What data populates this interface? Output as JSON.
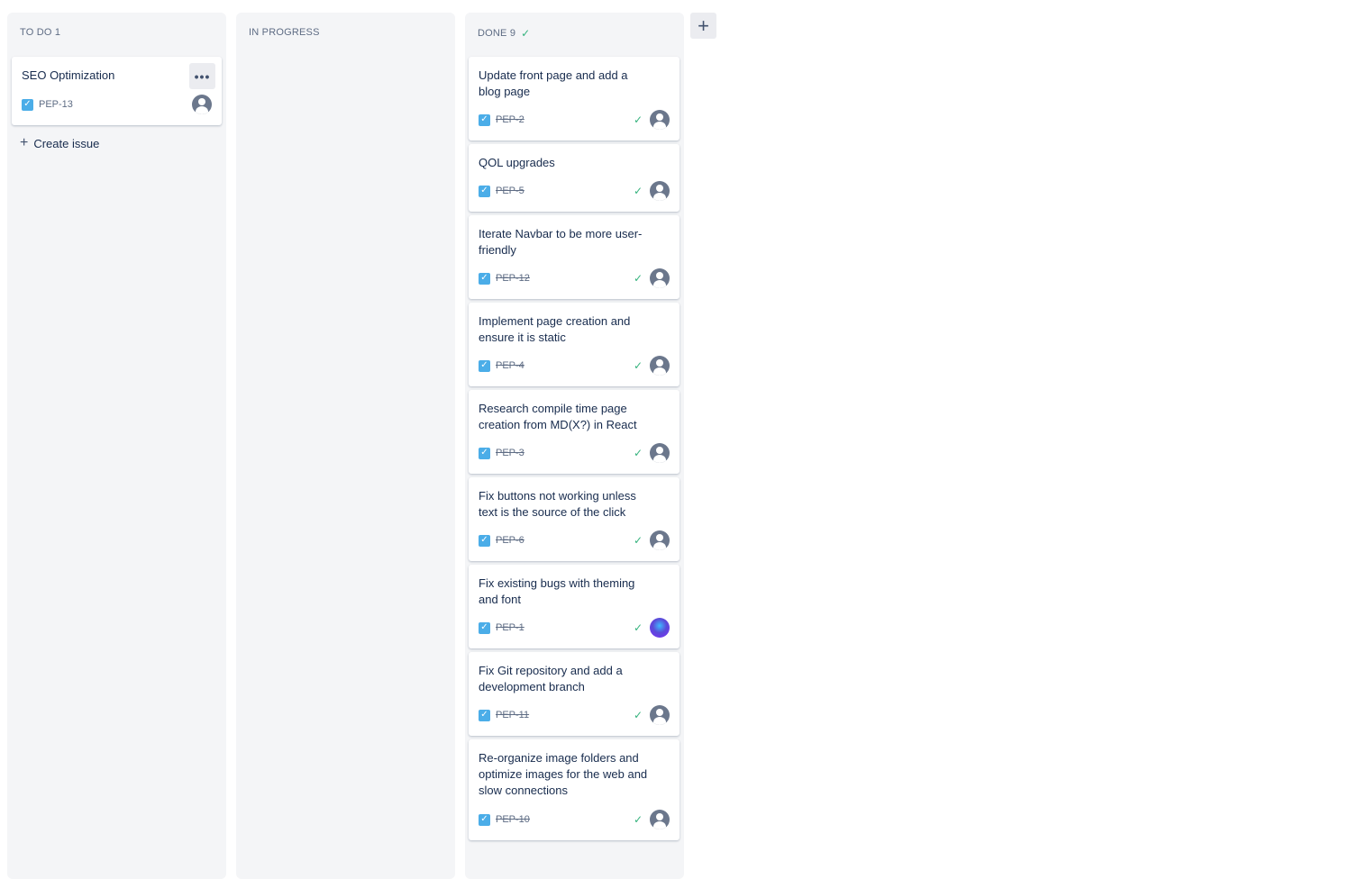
{
  "columns": {
    "todo": {
      "label": "TO DO 1"
    },
    "inprogress": {
      "label": "IN PROGRESS"
    },
    "done": {
      "label": "DONE 9",
      "check": "✓"
    }
  },
  "add_column": {
    "label": "+"
  },
  "todo_cards": [
    {
      "title": "SEO Optimization",
      "key": "PEP-13",
      "more": "•••"
    }
  ],
  "create_issue": {
    "plus": "+",
    "label": "Create issue"
  },
  "done_cards": [
    {
      "title": "Update front page and add a blog page",
      "key": "PEP-2"
    },
    {
      "title": "QOL upgrades",
      "key": "PEP-5"
    },
    {
      "title": "Iterate Navbar to be more user-friendly",
      "key": "PEP-12"
    },
    {
      "title": "Implement page creation and ensure it is static",
      "key": "PEP-4"
    },
    {
      "title": "Research compile time page creation from MD(X?) in React",
      "key": "PEP-3"
    },
    {
      "title": "Fix buttons not working unless text is the source of the click",
      "key": "PEP-6"
    },
    {
      "title": "Fix existing bugs with theming and font",
      "key": "PEP-1"
    },
    {
      "title": "Fix Git repository and add a development branch",
      "key": "PEP-11"
    },
    {
      "title": "Re-organize image folders and optimize images for the web and slow connections",
      "key": "PEP-10"
    }
  ],
  "icons": {
    "type": "checkbox-task-icon",
    "done": "check-icon",
    "avatar": "user-avatar-icon"
  },
  "colors": {
    "column_bg": "#f4f5f7",
    "task_icon": "#4bade8",
    "done_green": "#36b37e",
    "text": "#172b4d"
  }
}
